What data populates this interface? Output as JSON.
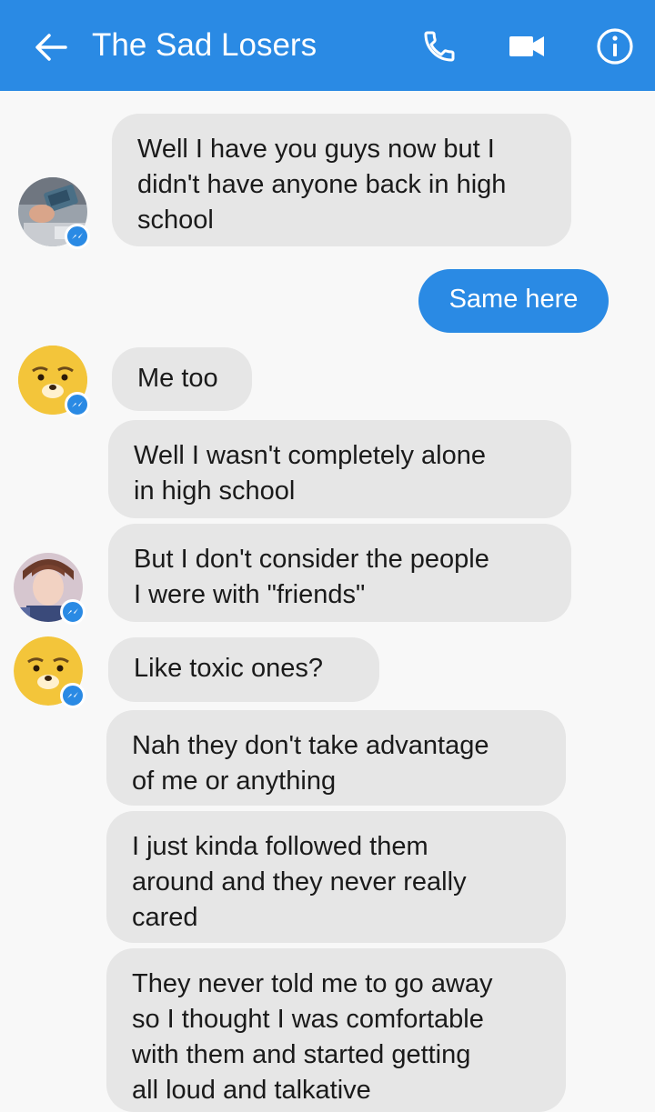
{
  "header": {
    "title": "The Sad Losers",
    "back_icon": "arrow-left-icon",
    "call_icon": "phone-icon",
    "video_icon": "video-camera-icon",
    "info_icon": "info-icon",
    "accent_color": "#2a8ae4"
  },
  "messages": [
    {
      "sender": "incoming",
      "text": "Well I have you guys now but I\ndidn't have anyone back in high\nschool"
    },
    {
      "sender": "outgoing",
      "text": "Same here"
    },
    {
      "sender": "incoming",
      "text": "Me too"
    },
    {
      "sender": "incoming",
      "text": "Well I wasn't completely alone\nin high school"
    },
    {
      "sender": "incoming",
      "text": "But I don't consider the people\nI were with \"friends\""
    },
    {
      "sender": "incoming",
      "text": "Like toxic ones?"
    },
    {
      "sender": "incoming",
      "text": "Nah they don't take advantage\nof me or anything"
    },
    {
      "sender": "incoming",
      "text": "I just kinda followed them\naround and they never really\ncared"
    },
    {
      "sender": "incoming",
      "text": "They never told me to go away\nso I thought I was comfortable\nwith them and started getting\nall loud and talkative"
    }
  ],
  "colors": {
    "incoming_bubble": "#e6e6e6",
    "outgoing_bubble": "#2a8ae4",
    "background": "#f8f8f8"
  }
}
